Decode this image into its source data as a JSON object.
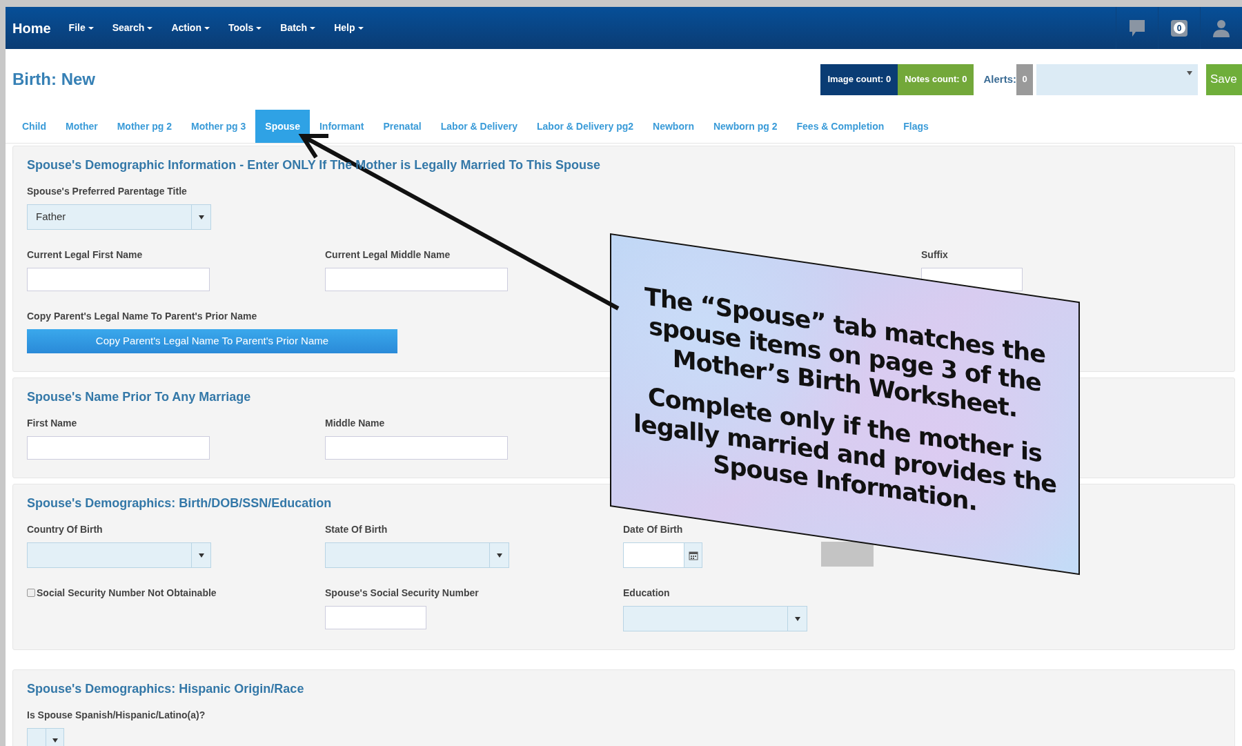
{
  "nav": {
    "brand": "Home",
    "menus": [
      "File",
      "Search",
      "Action",
      "Tools",
      "Batch",
      "Help"
    ],
    "notification_count": "0"
  },
  "header": {
    "title": "Birth: New",
    "image_count": "Image count: 0",
    "notes_count": "Notes count: 0",
    "alerts_label": "Alerts:",
    "alerts_count": "0",
    "save": "Save"
  },
  "tabs": [
    {
      "label": "Child",
      "selected": false
    },
    {
      "label": "Mother",
      "selected": false
    },
    {
      "label": "Mother pg 2",
      "selected": false
    },
    {
      "label": "Mother pg 3",
      "selected": false
    },
    {
      "label": "Spouse",
      "selected": true
    },
    {
      "label": "Informant",
      "selected": false
    },
    {
      "label": "Prenatal",
      "selected": false
    },
    {
      "label": "Labor & Delivery",
      "selected": false
    },
    {
      "label": "Labor & Delivery pg2",
      "selected": false
    },
    {
      "label": "Newborn",
      "selected": false
    },
    {
      "label": "Newborn pg 2",
      "selected": false
    },
    {
      "label": "Fees & Completion",
      "selected": false
    },
    {
      "label": "Flags",
      "selected": false
    }
  ],
  "sections": [
    {
      "title": "Spouse's Demographic Information - Enter ONLY If The Mother is Legally Married To This Spouse",
      "rows": [
        [
          {
            "kind": "select",
            "label": "Spouse's Preferred Parentage Title",
            "value": "Father"
          }
        ],
        [
          {
            "kind": "text",
            "label": "Current Legal First Name"
          },
          {
            "kind": "text",
            "label": "Current Legal Middle Name"
          },
          {
            "kind": "spacer"
          },
          {
            "kind": "short_text",
            "label": "Suffix"
          }
        ],
        [
          {
            "kind": "button",
            "label": "Copy Parent's Legal Name To Parent's Prior Name",
            "value": "Copy Parent's Legal Name To Parent's Prior Name"
          }
        ]
      ]
    },
    {
      "title": "Spouse's Name Prior To Any Marriage",
      "rows": [
        [
          {
            "kind": "text",
            "label": "First Name"
          },
          {
            "kind": "text",
            "label": "Middle Name"
          }
        ]
      ]
    },
    {
      "title": "Spouse's Demographics: Birth/DOB/SSN/Education",
      "rows": [
        [
          {
            "kind": "select",
            "label": "Country Of Birth"
          },
          {
            "kind": "select",
            "label": "State Of Birth"
          },
          {
            "kind": "date",
            "label": "Date Of Birth"
          },
          {
            "kind": "blank_button"
          }
        ],
        [
          {
            "kind": "checkbox",
            "label": "Social Security Number Not Obtainable",
            "checked": false
          },
          {
            "kind": "short_text",
            "label": "Spouse's Social Security Number"
          },
          {
            "kind": "select",
            "label": "Education"
          }
        ]
      ]
    },
    {
      "title": "Spouse's Demographics: Hispanic Origin/Race",
      "rows": [
        [
          {
            "kind": "mini_select",
            "label": "Is Spouse Spanish/Hispanic/Latino(a)?"
          }
        ]
      ]
    }
  ],
  "annotation": {
    "paragraphs": [
      [
        "The “Spouse” tab matches the",
        "spouse items on page 3 of the",
        "Mother’s Birth Worksheet."
      ],
      [
        "Complete only if the mother is",
        "legally married and provides the",
        "Spouse Information."
      ]
    ]
  }
}
